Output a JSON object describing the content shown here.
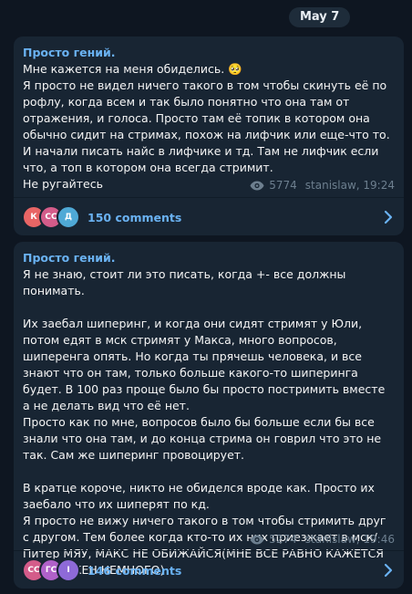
{
  "date": "May 7",
  "colors": {
    "background": "#0e1621",
    "bubble": "#182533",
    "accent": "#6ab2f2",
    "meta": "#6d7f8f"
  },
  "posts": [
    {
      "channel": "Просто гений.",
      "text": "Мне кажется на меня обиделись. 🥺\nЯ просто не видел ничего такого в том чтобы скинуть её по рофлу, когда всем и так было понятно что она там от отражения, и голоса. Просто там её топик в котором она обычно сидит на стримах, похож на лифчик или еще-что то. И начали писать найс в лифчике и тд. Там не лифчик если что, а топ в котором она всегда стримит.\nНе ругайтесь",
      "views": "5774",
      "author_time": "stanislaw, 19:24",
      "comments_label": "150 comments",
      "avatars": [
        {
          "text": "К",
          "color": "#e86565"
        },
        {
          "text": "СС",
          "color": "#d45c8a"
        },
        {
          "text": "Д",
          "color": "#4fa9d6"
        }
      ]
    },
    {
      "channel": "Просто гений.",
      "text": "Я не знаю, стоит ли это писать, когда +- все должны понимать.\n\nИх заебал шиперинг, и когда они сидят стримят у Юли, потом едят в мск стримят у Макса, много вопросов, шиперенга опять. Но когда ты прячешь человека, и все знают что он там, только больше какого-то шиперинга будет. В 100 раз проще было бы просто постримить вместе а не делать вид что её нет.\nПросто как по мне, вопросов было бы больше если бы все знали что она там, и до конца стрима он говрил что это не так. Сам же шиперинг провоцирует.\n\nВ кратце короче, никто не обиделся вроде как. Просто их заебало что их шиперят по кд.\nЯ просто не вижу ничего такого в том чтобы стримить друг с другом. Тем более когда кто-то их них приезжает в мск/Питер МЯУ, МАКС НЕ ОБИЖАЙСЯ(МНЕ ВСЕ РАВНО КАЖЕТСЯ ОН ОБИЖЕН НЕМНОГО)",
      "views": "5274",
      "author_time": "stanislaw, 19:46",
      "comments_label": "146 comments",
      "avatars": [
        {
          "text": "СС",
          "color": "#d45c8a"
        },
        {
          "text": "ГС",
          "color": "#b061c9"
        },
        {
          "text": "I",
          "color": "#8e6ad8"
        }
      ]
    }
  ]
}
